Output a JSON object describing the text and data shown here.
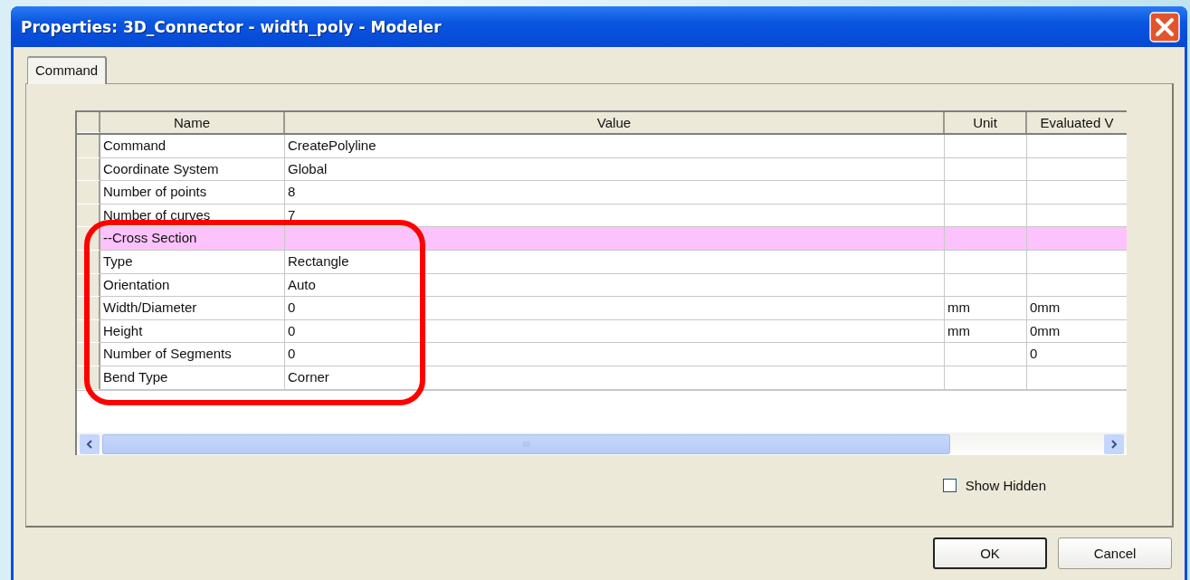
{
  "window": {
    "title": "Properties: 3D_Connector - width_poly - Modeler"
  },
  "tabs": [
    {
      "label": "Command",
      "selected": true
    }
  ],
  "table": {
    "columns": [
      "Name",
      "Value",
      "Unit",
      "Evaluated V"
    ],
    "rows": [
      {
        "kind": "property",
        "name": "Command",
        "value": "CreatePolyline"
      },
      {
        "kind": "property",
        "name": "Coordinate System",
        "value": "Global"
      },
      {
        "kind": "property",
        "name": "Number of points",
        "value": "8"
      },
      {
        "kind": "property",
        "name": "Number of curves",
        "value": "7"
      },
      {
        "kind": "section",
        "name": "--Cross Section"
      },
      {
        "kind": "property",
        "name": "Type",
        "value": "Rectangle"
      },
      {
        "kind": "property",
        "name": "Orientation",
        "value": "Auto"
      },
      {
        "kind": "property",
        "name": "Width/Diameter",
        "value": "0",
        "unit": "mm",
        "evaluated": "0mm"
      },
      {
        "kind": "property",
        "name": "Height",
        "value": "0",
        "unit": "mm",
        "evaluated": "0mm"
      },
      {
        "kind": "property",
        "name": "Number of Segments",
        "value": "0",
        "evaluated": "0"
      },
      {
        "kind": "property",
        "name": "Bend Type",
        "value": "Corner"
      }
    ]
  },
  "show_hidden": {
    "label": "Show Hidden",
    "checked": false
  },
  "buttons": [
    {
      "label": "OK",
      "default": true
    },
    {
      "label": "Cancel",
      "default": false
    }
  ]
}
